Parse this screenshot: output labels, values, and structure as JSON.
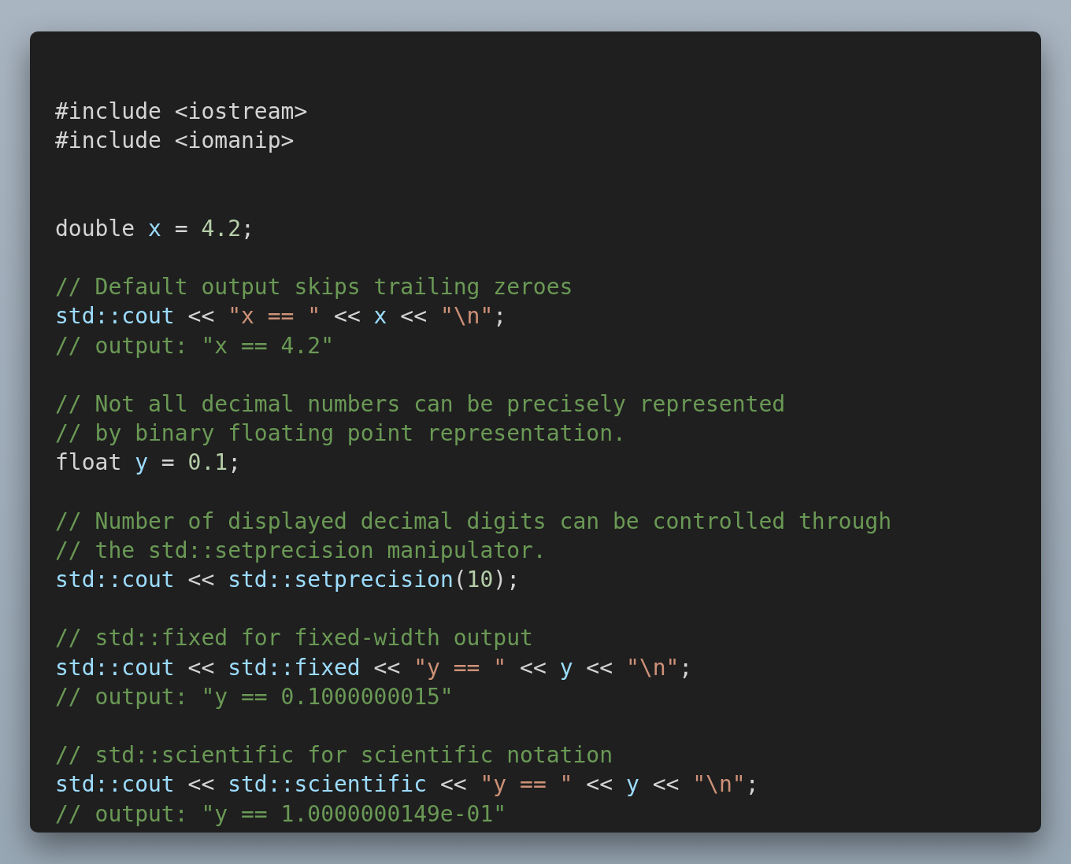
{
  "code_lines": [
    {
      "kind": "code",
      "tokens": [
        {
          "kind": "plain",
          "text": "#include <iostream>"
        }
      ]
    },
    {
      "kind": "code",
      "tokens": [
        {
          "kind": "plain",
          "text": "#include <iomanip>"
        }
      ]
    },
    {
      "kind": "blank"
    },
    {
      "kind": "blank"
    },
    {
      "kind": "code",
      "tokens": [
        {
          "kind": "plain",
          "text": "double "
        },
        {
          "kind": "ident",
          "text": "x"
        },
        {
          "kind": "plain",
          "text": " = "
        },
        {
          "kind": "number",
          "text": "4.2"
        },
        {
          "kind": "plain",
          "text": ";"
        }
      ]
    },
    {
      "kind": "blank"
    },
    {
      "kind": "code",
      "tokens": [
        {
          "kind": "comment",
          "text": "// Default output skips trailing zeroes"
        }
      ]
    },
    {
      "kind": "code",
      "tokens": [
        {
          "kind": "ident",
          "text": "std::cout"
        },
        {
          "kind": "plain",
          "text": " << "
        },
        {
          "kind": "string",
          "text": "\"x == \""
        },
        {
          "kind": "plain",
          "text": " << "
        },
        {
          "kind": "ident",
          "text": "x"
        },
        {
          "kind": "plain",
          "text": " << "
        },
        {
          "kind": "string",
          "text": "\"\\n\""
        },
        {
          "kind": "plain",
          "text": ";"
        }
      ]
    },
    {
      "kind": "code",
      "tokens": [
        {
          "kind": "comment",
          "text": "// output: \"x == 4.2\""
        }
      ]
    },
    {
      "kind": "blank"
    },
    {
      "kind": "code",
      "tokens": [
        {
          "kind": "comment",
          "text": "// Not all decimal numbers can be precisely represented"
        }
      ]
    },
    {
      "kind": "code",
      "tokens": [
        {
          "kind": "comment",
          "text": "// by binary floating point representation."
        }
      ]
    },
    {
      "kind": "code",
      "tokens": [
        {
          "kind": "plain",
          "text": "float "
        },
        {
          "kind": "ident",
          "text": "y"
        },
        {
          "kind": "plain",
          "text": " = "
        },
        {
          "kind": "number",
          "text": "0.1"
        },
        {
          "kind": "plain",
          "text": ";"
        }
      ]
    },
    {
      "kind": "blank"
    },
    {
      "kind": "code",
      "tokens": [
        {
          "kind": "comment",
          "text": "// Number of displayed decimal digits can be controlled through"
        }
      ]
    },
    {
      "kind": "code",
      "tokens": [
        {
          "kind": "comment",
          "text": "// the std::setprecision manipulator."
        }
      ]
    },
    {
      "kind": "code",
      "tokens": [
        {
          "kind": "ident",
          "text": "std::cout"
        },
        {
          "kind": "plain",
          "text": " << "
        },
        {
          "kind": "ident",
          "text": "std::setprecision"
        },
        {
          "kind": "plain",
          "text": "("
        },
        {
          "kind": "number",
          "text": "10"
        },
        {
          "kind": "plain",
          "text": ");"
        }
      ]
    },
    {
      "kind": "blank"
    },
    {
      "kind": "code",
      "tokens": [
        {
          "kind": "comment",
          "text": "// std::fixed for fixed-width output"
        }
      ]
    },
    {
      "kind": "code",
      "tokens": [
        {
          "kind": "ident",
          "text": "std::cout"
        },
        {
          "kind": "plain",
          "text": " << "
        },
        {
          "kind": "ident",
          "text": "std::fixed"
        },
        {
          "kind": "plain",
          "text": " << "
        },
        {
          "kind": "string",
          "text": "\"y == \""
        },
        {
          "kind": "plain",
          "text": " << "
        },
        {
          "kind": "ident",
          "text": "y"
        },
        {
          "kind": "plain",
          "text": " << "
        },
        {
          "kind": "string",
          "text": "\"\\n\""
        },
        {
          "kind": "plain",
          "text": ";"
        }
      ]
    },
    {
      "kind": "code",
      "tokens": [
        {
          "kind": "comment",
          "text": "// output: \"y == 0.1000000015\""
        }
      ]
    },
    {
      "kind": "blank"
    },
    {
      "kind": "code",
      "tokens": [
        {
          "kind": "comment",
          "text": "// std::scientific for scientific notation"
        }
      ]
    },
    {
      "kind": "code",
      "tokens": [
        {
          "kind": "ident",
          "text": "std::cout"
        },
        {
          "kind": "plain",
          "text": " << "
        },
        {
          "kind": "ident",
          "text": "std::scientific"
        },
        {
          "kind": "plain",
          "text": " << "
        },
        {
          "kind": "string",
          "text": "\"y == \""
        },
        {
          "kind": "plain",
          "text": " << "
        },
        {
          "kind": "ident",
          "text": "y"
        },
        {
          "kind": "plain",
          "text": " << "
        },
        {
          "kind": "string",
          "text": "\"\\n\""
        },
        {
          "kind": "plain",
          "text": ";"
        }
      ]
    },
    {
      "kind": "code",
      "tokens": [
        {
          "kind": "comment",
          "text": "// output: \"y == 1.0000000149e-01\""
        }
      ]
    }
  ]
}
